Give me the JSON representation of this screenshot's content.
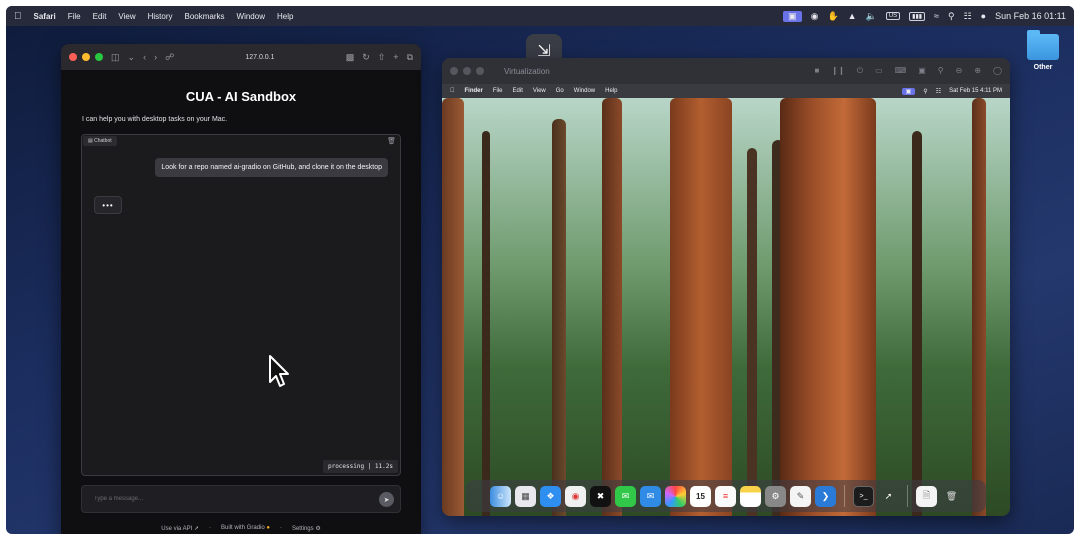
{
  "host_menubar": {
    "app": "Safari",
    "items": [
      "File",
      "Edit",
      "View",
      "History",
      "Bookmarks",
      "Window",
      "Help"
    ],
    "status": {
      "input_source": "US",
      "clock": "Sun Feb 16  01:11"
    }
  },
  "desktop": {
    "folder_label": "Other"
  },
  "safari": {
    "address": "127.0.0.1",
    "app_title": "CUA - AI Sandbox",
    "subtitle": "I can help you with desktop tasks on your Mac.",
    "chat_label": "Chatbot",
    "user_message": "Look for a repo named ai-gradio on GitHub, and clone it on the desktop",
    "pending_indicator": "•••",
    "status": "processing | 11.2s",
    "input_placeholder": "Type a message...",
    "footer": {
      "api": "Use via API",
      "built": "Built with Gradio",
      "settings": "Settings"
    }
  },
  "virtualization": {
    "window_title": "Virtualization",
    "guest_menubar": {
      "app": "Finder",
      "items": [
        "File",
        "Edit",
        "View",
        "Go",
        "Window",
        "Help"
      ],
      "clock": "Sat Feb 15  4:11 PM"
    },
    "dock_icons": [
      "finder-icon",
      "launchpad-icon",
      "safari-icon",
      "chrome-icon",
      "capcut-icon",
      "messages-icon",
      "mail-icon",
      "photos-icon",
      "calendar-icon",
      "reminders-icon",
      "notes-icon",
      "settings-icon",
      "textedit-icon",
      "vscode-icon",
      "terminal-icon",
      "rocket-icon",
      "document-icon",
      "trash-icon"
    ],
    "calendar_day": "15"
  },
  "colors": {
    "accent_purple": "#6a72e8",
    "traffic_red": "#ff5f57",
    "traffic_yellow": "#febc2e",
    "traffic_green": "#28c840"
  }
}
